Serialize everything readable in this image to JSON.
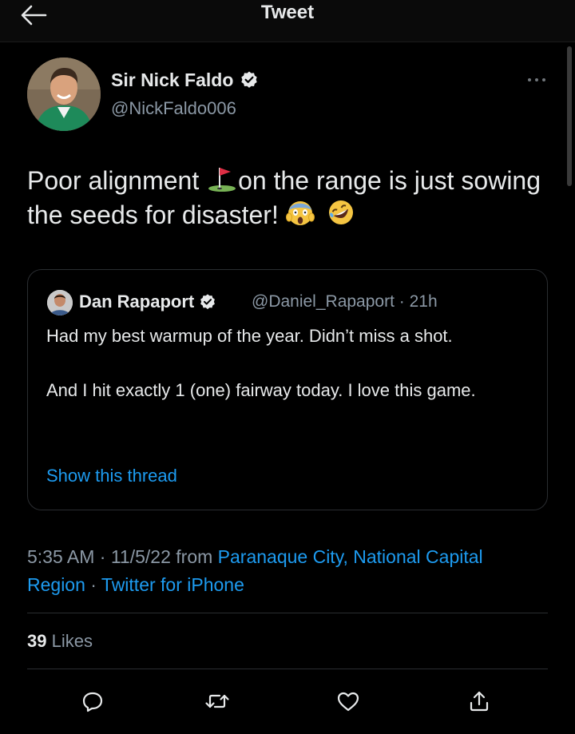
{
  "header": {
    "title": "Tweet",
    "back_icon": "arrow-left-icon"
  },
  "tweet": {
    "author_name": "Sir Nick Faldo",
    "author_handle": "@NickFaldo006",
    "text_part1": "Poor alignment ",
    "flag_emoji": "⛳",
    "text_part2": "on the range is just sowing the seeds for disaster! ",
    "emoji_scream": "😱",
    "emoji_laugh": "🤣",
    "more_icon": "more-horizontal-icon"
  },
  "quoted_tweet": {
    "author_name": "Dan Rapaport",
    "author_handle": "@Daniel_Rapaport",
    "separator": " · ",
    "time_ago": "21h",
    "paragraph1": "Had my best warmup of the year. Didn’t miss a shot.",
    "paragraph2": "And I hit exactly 1 (one) fairway today. I love this game.",
    "show_thread": "Show this thread"
  },
  "meta": {
    "time": "5:35 AM",
    "sep1": " · ",
    "date": "11/5/22",
    "from": " from ",
    "location": "Paranaque City, National Capital Region",
    "sep2": " · ",
    "client": "Twitter for iPhone"
  },
  "stats": {
    "likes_count": "39",
    "likes_label": " Likes"
  },
  "actions": {
    "reply_icon": "reply-icon",
    "retweet_icon": "retweet-icon",
    "like_icon": "heart-icon",
    "share_icon": "share-icon"
  },
  "colors": {
    "background": "#000000",
    "text": "#e7e9ea",
    "secondary": "#8b98a5",
    "link": "#1d9bf0",
    "border": "#2a2d31"
  }
}
